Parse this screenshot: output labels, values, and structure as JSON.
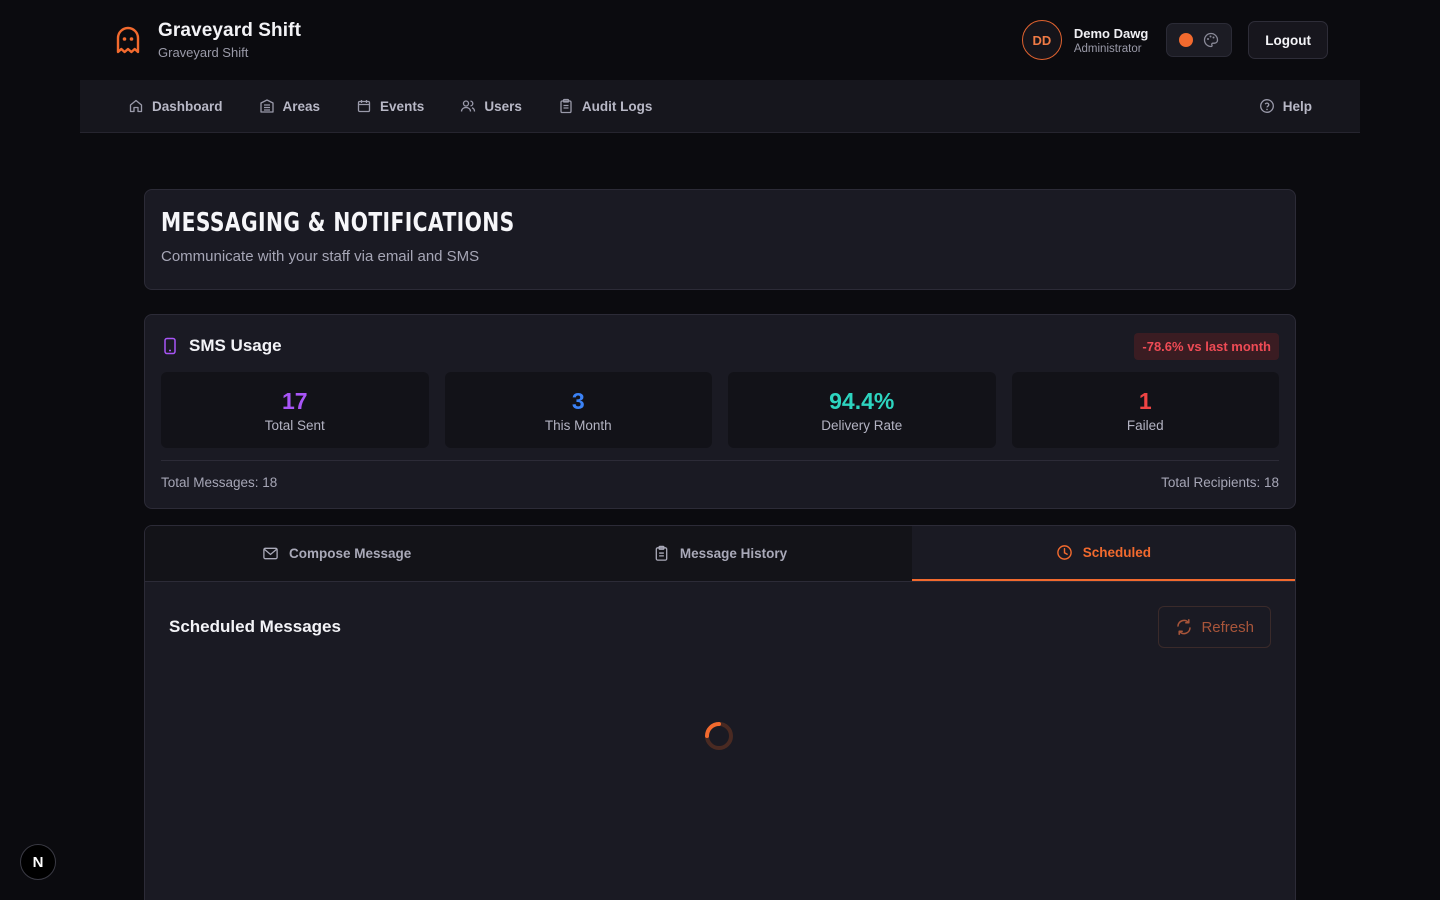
{
  "app": {
    "title": "Graveyard Shift",
    "subtitle": "Graveyard Shift"
  },
  "user": {
    "initials": "DD",
    "name": "Demo Dawg",
    "role": "Administrator"
  },
  "header": {
    "logout_label": "Logout"
  },
  "nav": {
    "items": [
      {
        "label": "Dashboard",
        "icon": "home-icon"
      },
      {
        "label": "Areas",
        "icon": "building-icon"
      },
      {
        "label": "Events",
        "icon": "calendar-icon"
      },
      {
        "label": "Users",
        "icon": "users-icon"
      },
      {
        "label": "Audit Logs",
        "icon": "clipboard-icon"
      }
    ],
    "help_label": "Help"
  },
  "page": {
    "title": "Messaging & Notifications",
    "subtitle": "Communicate with your staff via email and SMS"
  },
  "sms_usage": {
    "title": "SMS Usage",
    "delta_badge": "-78.6% vs last month",
    "stats": [
      {
        "value": "17",
        "label": "Total Sent",
        "color": "#a855f7"
      },
      {
        "value": "3",
        "label": "This Month",
        "color": "#3b82f6"
      },
      {
        "value": "94.4%",
        "label": "Delivery Rate",
        "color": "#2dd4bf"
      },
      {
        "value": "1",
        "label": "Failed",
        "color": "#ef4444"
      }
    ],
    "total_messages": "Total Messages: 18",
    "total_recipients": "Total Recipients: 18"
  },
  "tabs": [
    {
      "label": "Compose Message",
      "icon": "mail-icon",
      "active": false
    },
    {
      "label": "Message History",
      "icon": "clipboard-icon",
      "active": false
    },
    {
      "label": "Scheduled",
      "icon": "clock-icon",
      "active": true
    }
  ],
  "scheduled": {
    "title": "Scheduled Messages",
    "refresh_label": "Refresh"
  },
  "colors": {
    "accent": "#f26a2e",
    "background": "#0b0b0f",
    "card": "#1a1a23"
  },
  "dev_badge": "N"
}
